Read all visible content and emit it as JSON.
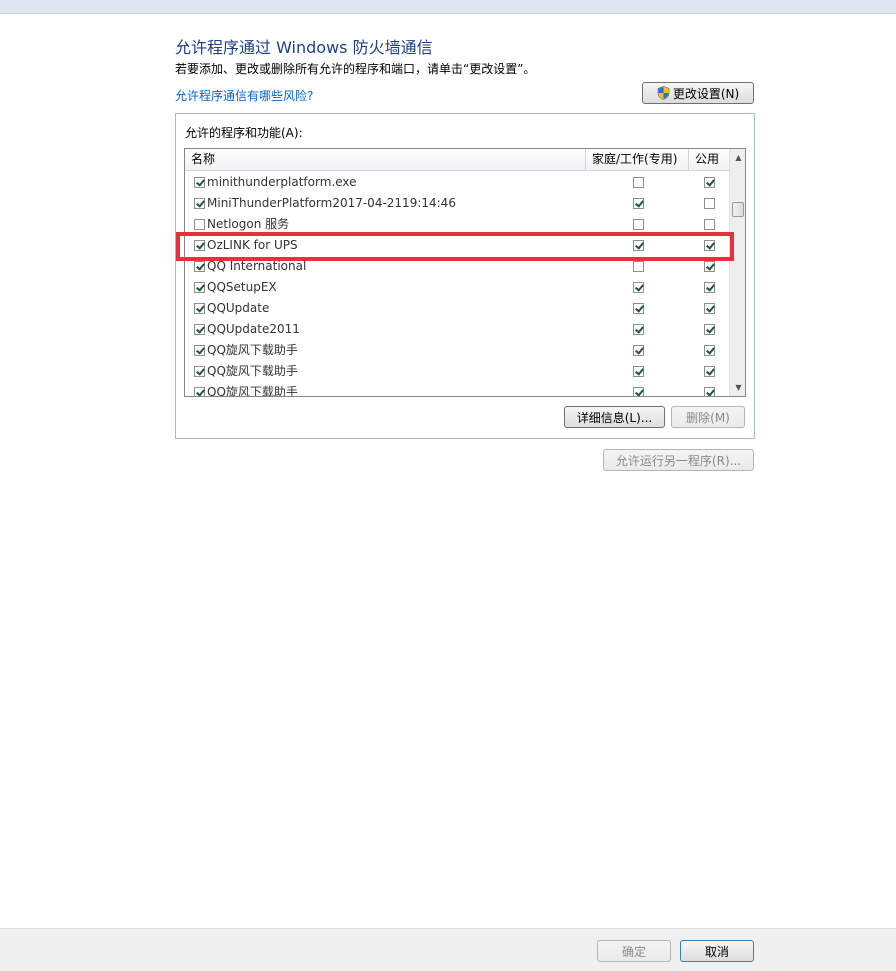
{
  "page": {
    "title": "允许程序通过 Windows 防火墙通信",
    "subtitle": "若要添加、更改或删除所有允许的程序和端口，请单击“更改设置”。",
    "risk_link": "允许程序通信有哪些风险?",
    "change_settings_label": "更改设置(N)"
  },
  "group": {
    "label": "允许的程序和功能(A):",
    "columns": {
      "name": "名称",
      "home": "家庭/工作(专用)",
      "public": "公用"
    },
    "rows": [
      {
        "name": "minithunderplatform.exe",
        "enabled": true,
        "home": false,
        "public": true
      },
      {
        "name": "MiniThunderPlatform2017-04-2119:14:46",
        "enabled": true,
        "home": true,
        "public": false
      },
      {
        "name": "Netlogon 服务",
        "enabled": false,
        "home": false,
        "public": false
      },
      {
        "name": "OzLINK for UPS",
        "enabled": true,
        "home": true,
        "public": true
      },
      {
        "name": "QQ International",
        "enabled": true,
        "home": false,
        "public": true
      },
      {
        "name": "QQSetupEX",
        "enabled": true,
        "home": true,
        "public": true
      },
      {
        "name": "QQUpdate",
        "enabled": true,
        "home": true,
        "public": true
      },
      {
        "name": "QQUpdate2011",
        "enabled": true,
        "home": true,
        "public": true
      },
      {
        "name": "QQ旋风下载助手",
        "enabled": true,
        "home": true,
        "public": true
      },
      {
        "name": "QQ旋风下载助手",
        "enabled": true,
        "home": true,
        "public": true
      },
      {
        "name": "QQ旋风下载助手",
        "enabled": true,
        "home": true,
        "public": true
      }
    ],
    "details_label": "详细信息(L)...",
    "delete_label": "删除(M)"
  },
  "allow_other_label": "允许运行另一程序(R)...",
  "footer": {
    "ok_label": "确定",
    "cancel_label": "取消"
  },
  "highlight_color": "#e8303a",
  "icons": {
    "shield": "uac-shield-icon",
    "scroll_up": "scroll-up-arrow",
    "scroll_down": "scroll-down-arrow"
  }
}
